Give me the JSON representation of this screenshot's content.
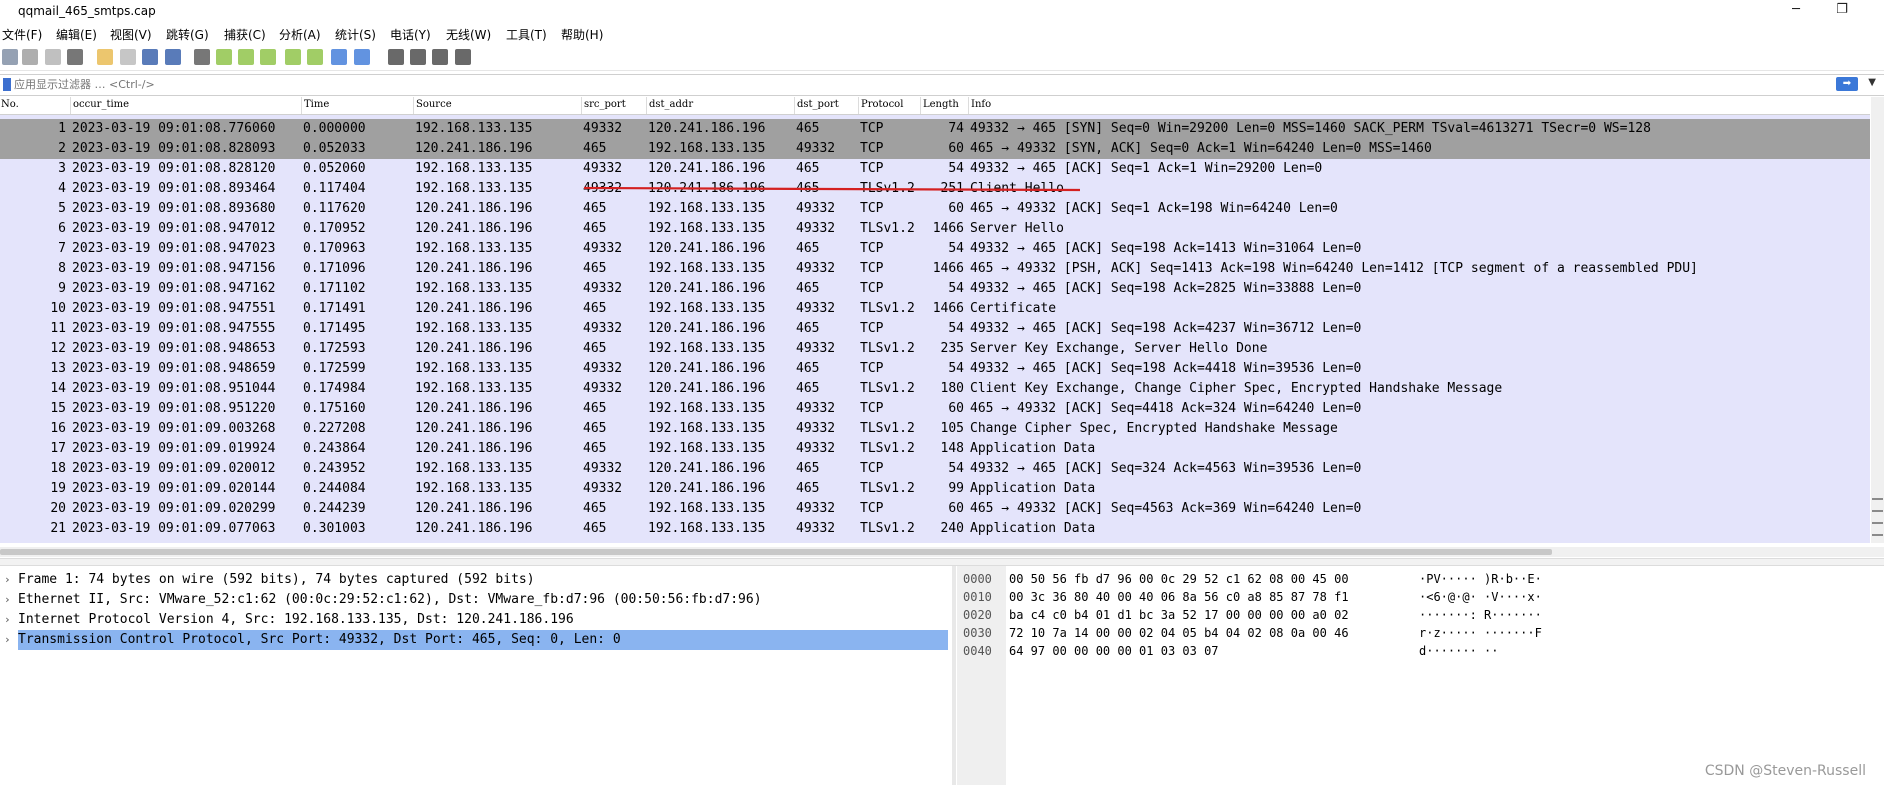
{
  "window": {
    "title": "qqmail_465_smtps.cap",
    "minimize": "─",
    "maximize": "❐"
  },
  "menu": [
    "文件(F)",
    "编辑(E)",
    "视图(V)",
    "跳转(G)",
    "捕获(C)",
    "分析(A)",
    "统计(S)",
    "电话(Y)",
    "无线(W)",
    "工具(T)",
    "帮助(H)"
  ],
  "toolbar_icons": [
    {
      "name": "shark-start-icon",
      "color": "#7a8aa0"
    },
    {
      "name": "stop-icon",
      "color": "#9a9a9a"
    },
    {
      "name": "restart-icon",
      "color": "#b0b0b0"
    },
    {
      "name": "options-gear-icon",
      "color": "#555"
    },
    {
      "name": "open-folder-icon",
      "color": "#e7b84a"
    },
    {
      "name": "save-icon",
      "color": "#b8b8b8"
    },
    {
      "name": "close-file-icon",
      "color": "#2f5aa8"
    },
    {
      "name": "reload-icon",
      "color": "#2f5aa8"
    },
    {
      "name": "find-icon",
      "color": "#555"
    },
    {
      "name": "go-back-icon",
      "color": "#8ac040"
    },
    {
      "name": "go-forward-icon",
      "color": "#8ac040"
    },
    {
      "name": "go-to-packet-icon",
      "color": "#8ac040"
    },
    {
      "name": "first-packet-icon",
      "color": "#8ac040"
    },
    {
      "name": "last-packet-icon",
      "color": "#8ac040"
    },
    {
      "name": "autoscroll-icon",
      "color": "#3b78d8"
    },
    {
      "name": "colorize-icon",
      "color": "#3b78d8"
    },
    {
      "name": "zoom-in-icon",
      "color": "#444"
    },
    {
      "name": "zoom-out-icon",
      "color": "#444"
    },
    {
      "name": "zoom-normal-icon",
      "color": "#444"
    },
    {
      "name": "resize-columns-icon",
      "color": "#444"
    }
  ],
  "filter": {
    "placeholder": "应用显示过滤器 … <Ctrl-/>"
  },
  "columns": [
    "No.",
    "occur_time",
    "Time",
    "Source",
    "src_port",
    "dst_addr",
    "dst_port",
    "Protocol",
    "Length",
    "Info"
  ],
  "packets": [
    [
      "1",
      "2023-03-19 09:01:08.776060",
      "0.000000",
      "192.168.133.135",
      "49332",
      "120.241.186.196",
      "465",
      "TCP",
      "74",
      "49332 → 465 [SYN] Seq=0 Win=29200 Len=0 MSS=1460 SACK_PERM TSval=4613271 TSecr=0 WS=128"
    ],
    [
      "2",
      "2023-03-19 09:01:08.828093",
      "0.052033",
      "120.241.186.196",
      "465",
      "192.168.133.135",
      "49332",
      "TCP",
      "60",
      "465 → 49332 [SYN, ACK] Seq=0 Ack=1 Win=64240 Len=0 MSS=1460"
    ],
    [
      "3",
      "2023-03-19 09:01:08.828120",
      "0.052060",
      "192.168.133.135",
      "49332",
      "120.241.186.196",
      "465",
      "TCP",
      "54",
      "49332 → 465 [ACK] Seq=1 Ack=1 Win=29200 Len=0"
    ],
    [
      "4",
      "2023-03-19 09:01:08.893464",
      "0.117404",
      "192.168.133.135",
      "49332",
      "120.241.186.196",
      "465",
      "TLSv1.2",
      "251",
      "Client Hello"
    ],
    [
      "5",
      "2023-03-19 09:01:08.893680",
      "0.117620",
      "120.241.186.196",
      "465",
      "192.168.133.135",
      "49332",
      "TCP",
      "60",
      "465 → 49332 [ACK] Seq=1 Ack=198 Win=64240 Len=0"
    ],
    [
      "6",
      "2023-03-19 09:01:08.947012",
      "0.170952",
      "120.241.186.196",
      "465",
      "192.168.133.135",
      "49332",
      "TLSv1.2",
      "1466",
      "Server Hello"
    ],
    [
      "7",
      "2023-03-19 09:01:08.947023",
      "0.170963",
      "192.168.133.135",
      "49332",
      "120.241.186.196",
      "465",
      "TCP",
      "54",
      "49332 → 465 [ACK] Seq=198 Ack=1413 Win=31064 Len=0"
    ],
    [
      "8",
      "2023-03-19 09:01:08.947156",
      "0.171096",
      "120.241.186.196",
      "465",
      "192.168.133.135",
      "49332",
      "TCP",
      "1466",
      "465 → 49332 [PSH, ACK] Seq=1413 Ack=198 Win=64240 Len=1412 [TCP segment of a reassembled PDU]"
    ],
    [
      "9",
      "2023-03-19 09:01:08.947162",
      "0.171102",
      "192.168.133.135",
      "49332",
      "120.241.186.196",
      "465",
      "TCP",
      "54",
      "49332 → 465 [ACK] Seq=198 Ack=2825 Win=33888 Len=0"
    ],
    [
      "10",
      "2023-03-19 09:01:08.947551",
      "0.171491",
      "120.241.186.196",
      "465",
      "192.168.133.135",
      "49332",
      "TLSv1.2",
      "1466",
      "Certificate"
    ],
    [
      "11",
      "2023-03-19 09:01:08.947555",
      "0.171495",
      "192.168.133.135",
      "49332",
      "120.241.186.196",
      "465",
      "TCP",
      "54",
      "49332 → 465 [ACK] Seq=198 Ack=4237 Win=36712 Len=0"
    ],
    [
      "12",
      "2023-03-19 09:01:08.948653",
      "0.172593",
      "120.241.186.196",
      "465",
      "192.168.133.135",
      "49332",
      "TLSv1.2",
      "235",
      "Server Key Exchange, Server Hello Done"
    ],
    [
      "13",
      "2023-03-19 09:01:08.948659",
      "0.172599",
      "192.168.133.135",
      "49332",
      "120.241.186.196",
      "465",
      "TCP",
      "54",
      "49332 → 465 [ACK] Seq=198 Ack=4418 Win=39536 Len=0"
    ],
    [
      "14",
      "2023-03-19 09:01:08.951044",
      "0.174984",
      "192.168.133.135",
      "49332",
      "120.241.186.196",
      "465",
      "TLSv1.2",
      "180",
      "Client Key Exchange, Change Cipher Spec, Encrypted Handshake Message"
    ],
    [
      "15",
      "2023-03-19 09:01:08.951220",
      "0.175160",
      "120.241.186.196",
      "465",
      "192.168.133.135",
      "49332",
      "TCP",
      "60",
      "465 → 49332 [ACK] Seq=4418 Ack=324 Win=64240 Len=0"
    ],
    [
      "16",
      "2023-03-19 09:01:09.003268",
      "0.227208",
      "120.241.186.196",
      "465",
      "192.168.133.135",
      "49332",
      "TLSv1.2",
      "105",
      "Change Cipher Spec, Encrypted Handshake Message"
    ],
    [
      "17",
      "2023-03-19 09:01:09.019924",
      "0.243864",
      "120.241.186.196",
      "465",
      "192.168.133.135",
      "49332",
      "TLSv1.2",
      "148",
      "Application Data"
    ],
    [
      "18",
      "2023-03-19 09:01:09.020012",
      "0.243952",
      "192.168.133.135",
      "49332",
      "120.241.186.196",
      "465",
      "TCP",
      "54",
      "49332 → 465 [ACK] Seq=324 Ack=4563 Win=39536 Len=0"
    ],
    [
      "19",
      "2023-03-19 09:01:09.020144",
      "0.244084",
      "192.168.133.135",
      "49332",
      "120.241.186.196",
      "465",
      "TLSv1.2",
      "99",
      "Application Data"
    ],
    [
      "20",
      "2023-03-19 09:01:09.020299",
      "0.244239",
      "120.241.186.196",
      "465",
      "192.168.133.135",
      "49332",
      "TCP",
      "60",
      "465 → 49332 [ACK] Seq=4563 Ack=369 Win=64240 Len=0"
    ],
    [
      "21",
      "2023-03-19 09:01:09.077063",
      "0.301003",
      "120.241.186.196",
      "465",
      "192.168.133.135",
      "49332",
      "TLSv1.2",
      "240",
      "Application Data"
    ]
  ],
  "details": [
    "Frame 1: 74 bytes on wire (592 bits), 74 bytes captured (592 bits)",
    "Ethernet II, Src: VMware_52:c1:62 (00:0c:29:52:c1:62), Dst: VMware_fb:d7:96 (00:50:56:fb:d7:96)",
    "Internet Protocol Version 4, Src: 192.168.133.135, Dst: 120.241.186.196",
    "Transmission Control Protocol, Src Port: 49332, Dst Port: 465, Seq: 0, Len: 0"
  ],
  "hex_dump": [
    {
      "offset": "0000",
      "hex": "00 50 56 fb d7 96 00 0c  29 52 c1 62 08 00 45 00",
      "ascii": "·PV····· )R·b··E·"
    },
    {
      "offset": "0010",
      "hex": "00 3c 36 80 40 00 40 06  8a 56 c0 a8 85 87 78 f1",
      "ascii": "·<6·@·@· ·V····x·"
    },
    {
      "offset": "0020",
      "hex": "ba c4 c0 b4 01 d1 bc 3a  52 17 00 00 00 00 a0 02",
      "ascii": "·······: R·······"
    },
    {
      "offset": "0030",
      "hex": "72 10 7a 14 00 00 02 04  05 b4 04 02 08 0a 00 46",
      "ascii": "r·z····· ·······F"
    },
    {
      "offset": "0040",
      "hex": "64 97 00 00 00 00 01 03  03 07",
      "ascii": "d······· ··"
    }
  ],
  "watermark": "CSDN @Steven-Russell"
}
